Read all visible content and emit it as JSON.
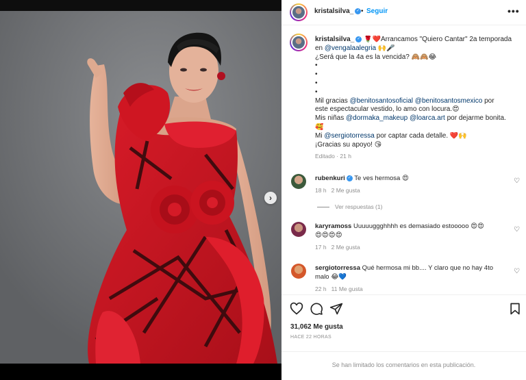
{
  "post": {
    "username": "kristalsilva_",
    "follow_label": "Seguir",
    "more_label": "•••"
  },
  "caption": {
    "username": "kristalsilva_",
    "line1_text": " 🌹❤️Arrancamos \"Quiero Cantar\" 2a temporada",
    "line2_prefix": "en ",
    "line2_mention": "@vengalaalegria",
    "line2_suffix": " 🙌🎤",
    "line3": "¿Será que la 4a es la vencida? 🙈🙈😂",
    "bullets": [
      "•",
      "•",
      "•",
      "•"
    ],
    "line4_prefix": "Mil gracias ",
    "line4_mention1": "@benitosantosoficial",
    "line4_mention2": "@benitosantosmexico",
    "line4_suffix": " por",
    "line5": "este espectacular vestido, lo amo con locura.😍",
    "line6_prefix": "Mis niñas ",
    "line6_mention1": "@dormaka_makeup",
    "line6_mention2": "@loarca.art",
    "line6_suffix": " por dejarme bonita.",
    "line7": "🥰",
    "line8_prefix": "Mi ",
    "line8_mention": "@sergiotorressa",
    "line8_suffix": " por captar cada detalle. ❤️🙌",
    "line9": "¡Gracias su apoyo! 😘",
    "meta": "Editado · 21 h"
  },
  "comments": [
    {
      "username": "rubenkuri",
      "text": " Te ves hermosa 😍",
      "time": "18 h",
      "likes": "2 Me gusta"
    },
    {
      "username": "karyramoss",
      "text": " Uuuuuggghhhh es demasiado estooooo 😍😍",
      "text2": "😍😍😍😍",
      "time": "17 h",
      "likes": "2 Me gusta"
    },
    {
      "username": "sergiotorressa",
      "text": " Qué hermosa mi bb.... Y claro que no hay 4to",
      "text2": "malo 😂💙",
      "time": "22 h",
      "likes": "11 Me gusta"
    }
  ],
  "replies_label": "Ver respuestas (1)",
  "likes_count": "31,062 Me gusta",
  "post_time": "HACE 22 HORAS",
  "comments_closed": "Se han limitado los comentarios en esta publicación.",
  "colors": {
    "dress_red": "#c8121d",
    "link_blue": "#0095f6",
    "mention_blue": "#00376b",
    "background_gray": "#737578"
  },
  "icons": {
    "like": "heart-icon",
    "comment": "comment-icon",
    "share": "send-icon",
    "save": "bookmark-icon",
    "next": "chevron-right-icon"
  }
}
